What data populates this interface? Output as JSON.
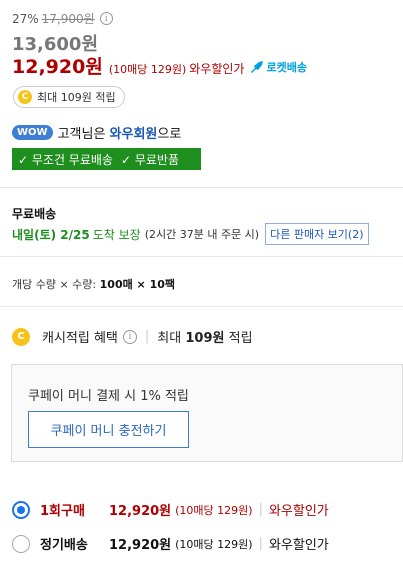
{
  "price": {
    "discount_rate": "27%",
    "original_price": "17,900원",
    "sale_price": "13,600원",
    "wow_price": "12,920원",
    "wow_unit_price": "(10매당 129원)",
    "wow_label": "와우할인가",
    "rocket_label": "로켓배송"
  },
  "cash": {
    "coin_symbol": "C",
    "pill_text": "최대 109원 적립"
  },
  "wow": {
    "badge": "WOW",
    "prefix": "고객님은",
    "member": "와우회원",
    "suffix": "으로"
  },
  "free_bar": {
    "item1": "✓ 무조건 무료배송",
    "item2": "✓ 무료반품"
  },
  "shipping": {
    "title": "무료배송",
    "date": "내일(토) 2/25",
    "guarantee": "도착 보장",
    "note": "(2시간 37분 내 주문 시)",
    "other_seller": "다른 판매자 보기(2)"
  },
  "quantity": {
    "label": "개당 수량 × 수량:",
    "value": "100매 × 10팩"
  },
  "cash_benefit": {
    "label": "캐시적립 혜택",
    "max_text": "최대",
    "amount": "109원",
    "suffix": "적립"
  },
  "coupay": {
    "text": "쿠페이 머니 결제 시 1% 적립",
    "button": "쿠페이 머니 충전하기"
  },
  "purchase_options": [
    {
      "name": "1회구매",
      "price": "12,920원",
      "unit": "(10매당 129원)",
      "label": "와우할인가",
      "selected": true
    },
    {
      "name": "정기배송",
      "price": "12,920원",
      "unit": "(10매당 129원)",
      "label": "와우할인가",
      "selected": false
    }
  ],
  "colors": {
    "wow_red": "#ae0000",
    "green": "#1e8e1e",
    "blue": "#1a57b8",
    "rocket": "#00a2de"
  }
}
